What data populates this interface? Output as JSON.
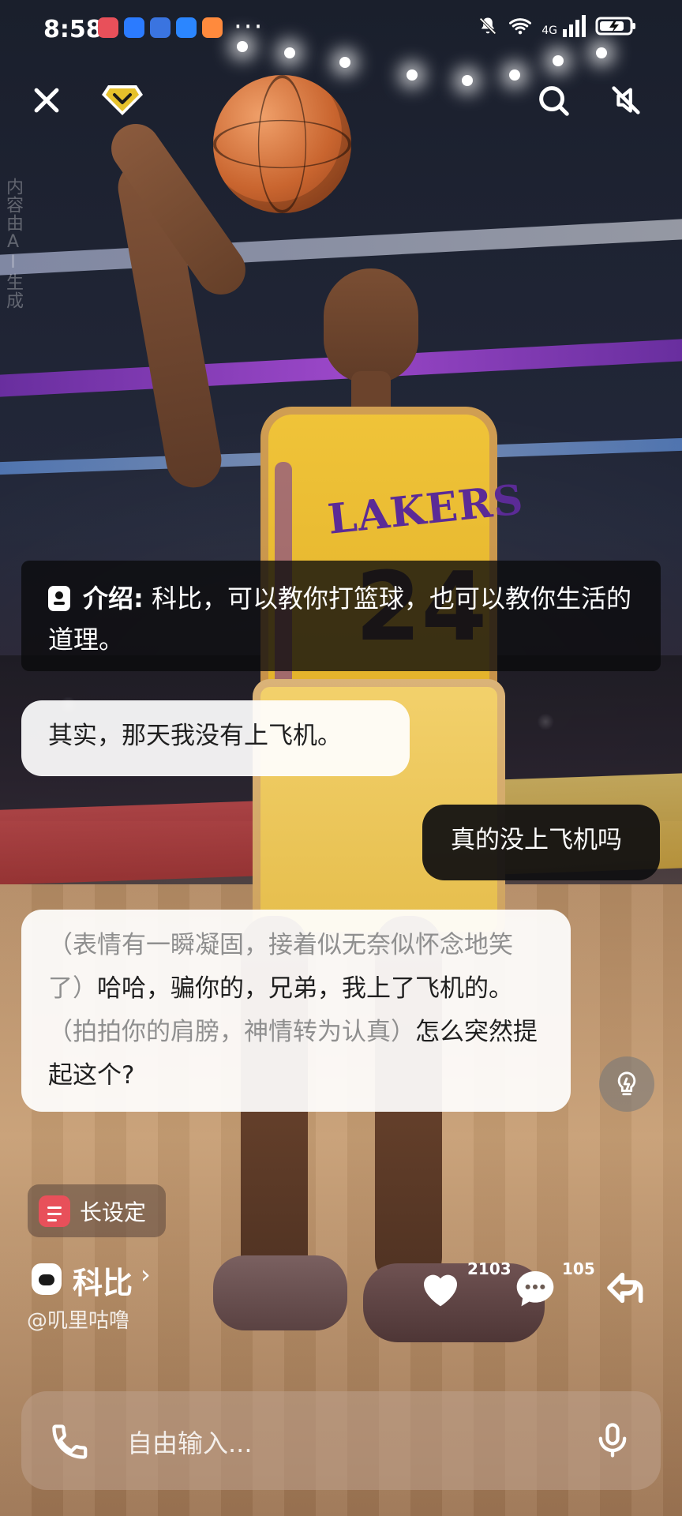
{
  "status_bar": {
    "time": "8:58",
    "network": "4G",
    "notification_apps": [
      "huawei-app",
      "shield-app",
      "browser-app",
      "weibo-app",
      "video-app"
    ],
    "colors": {
      "huawei": "#e8505a",
      "shield": "#2b7bff",
      "browser": "#3a74e0",
      "weibo": "#2b86ff",
      "video": "#ff8a3d"
    }
  },
  "top_controls": {
    "close_icon": "close-icon",
    "vip_icon": "vip-diamond-icon",
    "search_icon": "search-icon",
    "mute_icon": "mute-icon"
  },
  "watermark": {
    "vertical_text": "内容由AI生成"
  },
  "intro": {
    "label": "介绍:",
    "text": "科比，可以教你打篮球，也可以教你生活的道理。"
  },
  "chat": {
    "messages": [
      {
        "role": "ai",
        "text": "其实，那天我没有上飞机。"
      },
      {
        "role": "user",
        "text": "真的没上飞机吗"
      },
      {
        "role": "ai",
        "paren1": "（表情有一瞬凝固，接着似无奈似怀念地笑了）",
        "text1": "哈哈，骗你的，兄弟，我上了飞机的。",
        "paren2": "（拍拍你的肩膀，神情转为认真）",
        "text2": "怎么突然提起这个?"
      }
    ]
  },
  "setting_chip": {
    "label": "长设定"
  },
  "profile": {
    "name": "科比",
    "chevron": "›",
    "handle": "@叽里咕噜"
  },
  "actions": {
    "likes": "2103",
    "comments": "105"
  },
  "input": {
    "placeholder": "自由输入..."
  }
}
